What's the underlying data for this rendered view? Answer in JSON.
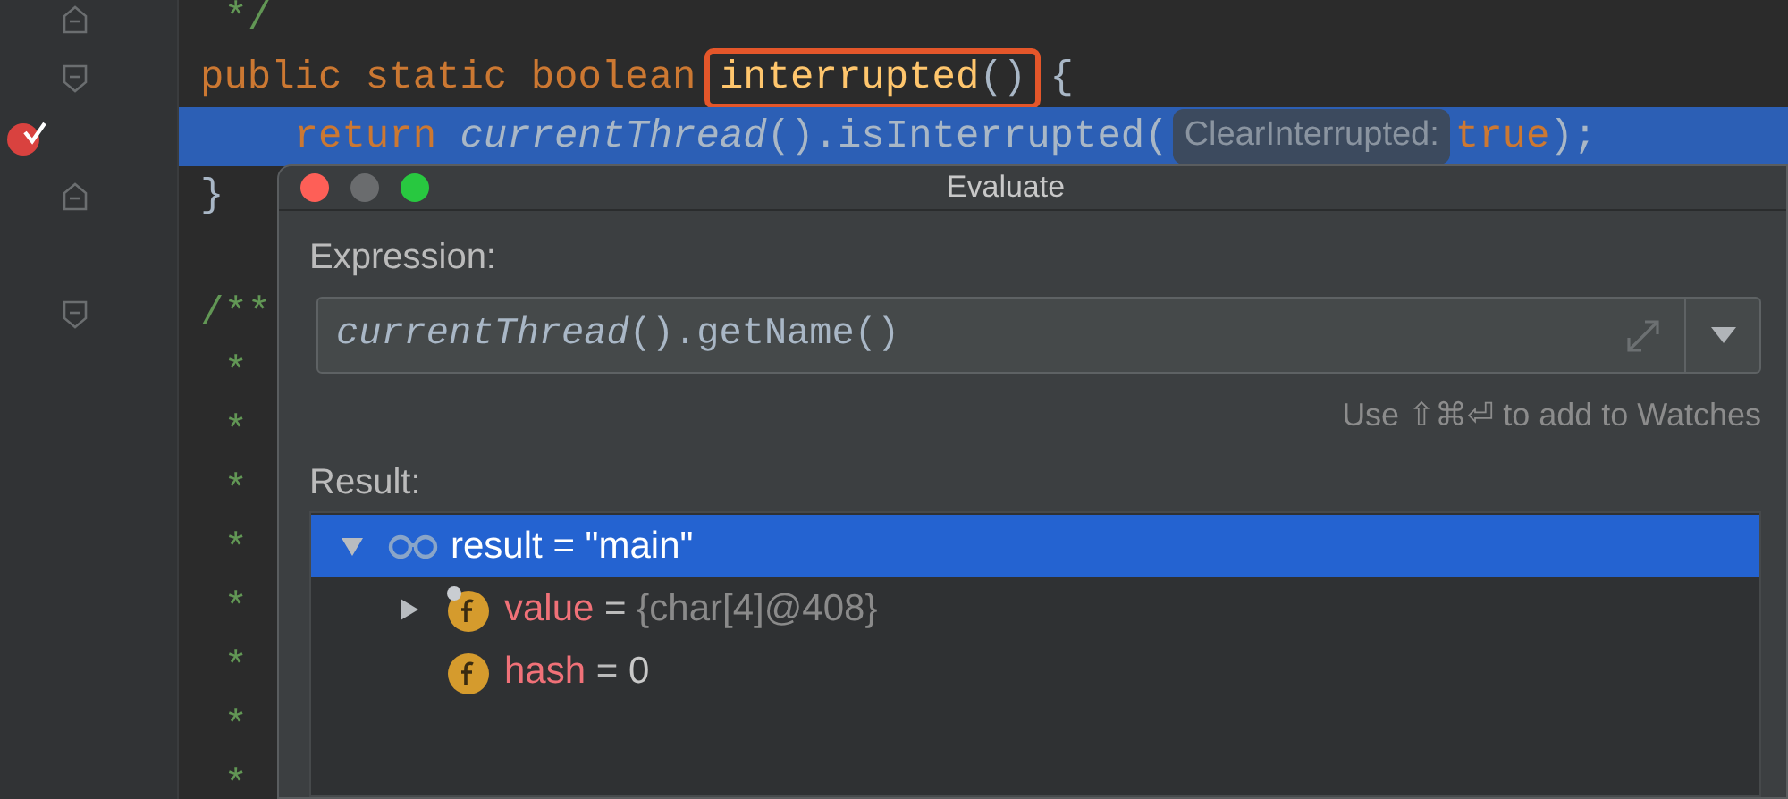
{
  "editor": {
    "lines": [
      {
        "fold_close": true,
        "tokens": [
          {
            "kind": "comment",
            "text": " */"
          }
        ]
      },
      {
        "fold_open": true,
        "tokens": [
          {
            "kind": "keyword",
            "text": "public static boolean "
          },
          {
            "kind": "boxed",
            "tokens": [
              {
                "kind": "declaration",
                "text": "interrupted"
              },
              {
                "kind": "plain",
                "text": "()"
              }
            ]
          },
          {
            "kind": "plain",
            "text": " {"
          }
        ]
      },
      {
        "breakpoint": true,
        "current": true,
        "tokens": [
          {
            "kind": "keyword",
            "text": "    return "
          },
          {
            "kind": "italic",
            "text": "currentThread"
          },
          {
            "kind": "plain",
            "text": "().isInterrupted("
          },
          {
            "kind": "hint",
            "text": "ClearInterrupted:"
          },
          {
            "kind": "keyword",
            "text": "true"
          },
          {
            "kind": "plain",
            "text": ");"
          }
        ]
      },
      {
        "fold_close": true,
        "tokens": [
          {
            "kind": "plain",
            "text": "}"
          }
        ]
      },
      {
        "fold_open": true,
        "blank_before": true,
        "tokens": [
          {
            "kind": "comment",
            "text": "/**"
          }
        ]
      },
      {
        "tokens": [
          {
            "kind": "comment",
            "text": " *"
          }
        ]
      },
      {
        "tokens": [
          {
            "kind": "comment",
            "text": " *"
          }
        ]
      },
      {
        "tokens": [
          {
            "kind": "comment",
            "text": " *"
          }
        ]
      },
      {
        "tokens": [
          {
            "kind": "comment",
            "text": " *"
          }
        ]
      },
      {
        "tokens": [
          {
            "kind": "comment",
            "text": " *"
          }
        ]
      },
      {
        "tokens": [
          {
            "kind": "comment",
            "text": " *"
          }
        ]
      },
      {
        "tokens": [
          {
            "kind": "comment",
            "text": " *"
          }
        ]
      },
      {
        "tokens": [
          {
            "kind": "comment",
            "text": " *"
          }
        ]
      }
    ]
  },
  "dialog": {
    "title": "Evaluate",
    "expression": {
      "label": "Expression:",
      "value": [
        {
          "kind": "italic",
          "text": "currentThread"
        },
        {
          "kind": "plain",
          "text": "().getName()"
        }
      ],
      "hint": "Use ⇧⌘⏎ to add to Watches"
    },
    "result": {
      "label": "Result:",
      "tree": [
        {
          "kind": "watch",
          "name": "result",
          "operator": " = ",
          "value": "\"main\"",
          "dimmed": false,
          "selected": true,
          "expanded": true,
          "children": [
            {
              "kind": "field",
              "final": true,
              "name": "value",
              "operator": " = ",
              "value": "{char[4]@408}",
              "dimmed": true,
              "selected": false,
              "expanded": false
            },
            {
              "kind": "field",
              "final": false,
              "name": "hash",
              "operator": " = ",
              "value": "0",
              "dimmed": false,
              "selected": false
            }
          ]
        }
      ]
    }
  }
}
